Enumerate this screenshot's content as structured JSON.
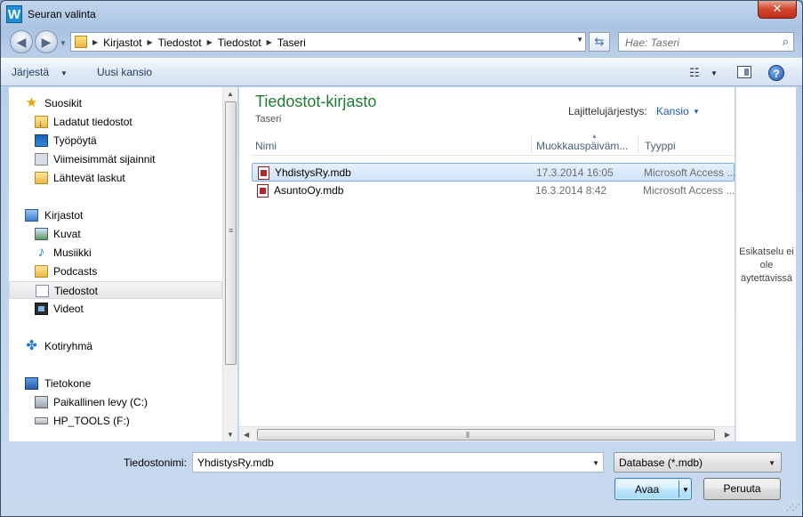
{
  "window": {
    "app_icon_letter": "W",
    "title": "Seuran valinta",
    "close_glyph": "✕"
  },
  "address": {
    "breadcrumbs": [
      "Kirjastot",
      "Tiedostot",
      "Tiedostot",
      "Taseri"
    ],
    "search_placeholder": "Hae: Taseri"
  },
  "toolbar": {
    "organize_label": "Järjestä",
    "new_folder_label": "Uusi kansio"
  },
  "navigation": {
    "favorites": {
      "label": "Suosikit",
      "items": [
        {
          "label": "Ladatut tiedostot",
          "icon": "downloads-folder-icon"
        },
        {
          "label": "Työpöytä",
          "icon": "desktop-icon"
        },
        {
          "label": "Viimeisimmät sijainnit",
          "icon": "recent-places-icon"
        },
        {
          "label": "Lähtevät laskut",
          "icon": "folder-icon"
        }
      ]
    },
    "libraries": {
      "label": "Kirjastot",
      "items": [
        {
          "label": "Kuvat",
          "icon": "pictures-icon"
        },
        {
          "label": "Musiikki",
          "icon": "music-icon"
        },
        {
          "label": "Podcasts",
          "icon": "folder-icon"
        },
        {
          "label": "Tiedostot",
          "icon": "documents-icon",
          "selected": true
        },
        {
          "label": "Videot",
          "icon": "videos-icon"
        }
      ]
    },
    "homegroup": {
      "label": "Kotiryhmä"
    },
    "computer": {
      "label": "Tietokone",
      "items": [
        {
          "label": "Paikallinen levy (C:)",
          "icon": "local-disk-icon"
        },
        {
          "label": "HP_TOOLS (F:)",
          "icon": "usb-drive-icon"
        }
      ]
    }
  },
  "main": {
    "library_title": "Tiedostot-kirjasto",
    "library_subtitle": "Taseri",
    "sort_label": "Lajittelujärjestys:",
    "sort_value": "Kansio",
    "columns": {
      "name": "Nimi",
      "date": "Muokkauspäiväm...",
      "type": "Tyyppi"
    },
    "files": [
      {
        "name": "YhdistysRy.mdb",
        "date": "17.3.2014 16:05",
        "type": "Microsoft Access ...",
        "selected": true
      },
      {
        "name": "AsuntoOy.mdb",
        "date": "16.3.2014 8:42",
        "type": "Microsoft Access ...",
        "selected": false
      }
    ]
  },
  "preview": {
    "line1": "Esikatselu ei",
    "line2": "ole",
    "line3": "äytettävissä"
  },
  "bottom": {
    "filename_label": "Tiedostonimi:",
    "filename_value": "YhdistysRy.mdb",
    "filter_value": "Database (*.mdb)",
    "open_label": "Avaa",
    "cancel_label": "Peruuta"
  },
  "colors": {
    "library_title": "#1e7b32",
    "sort_value": "#1d5bb5",
    "selection": "#cfe3f8"
  }
}
